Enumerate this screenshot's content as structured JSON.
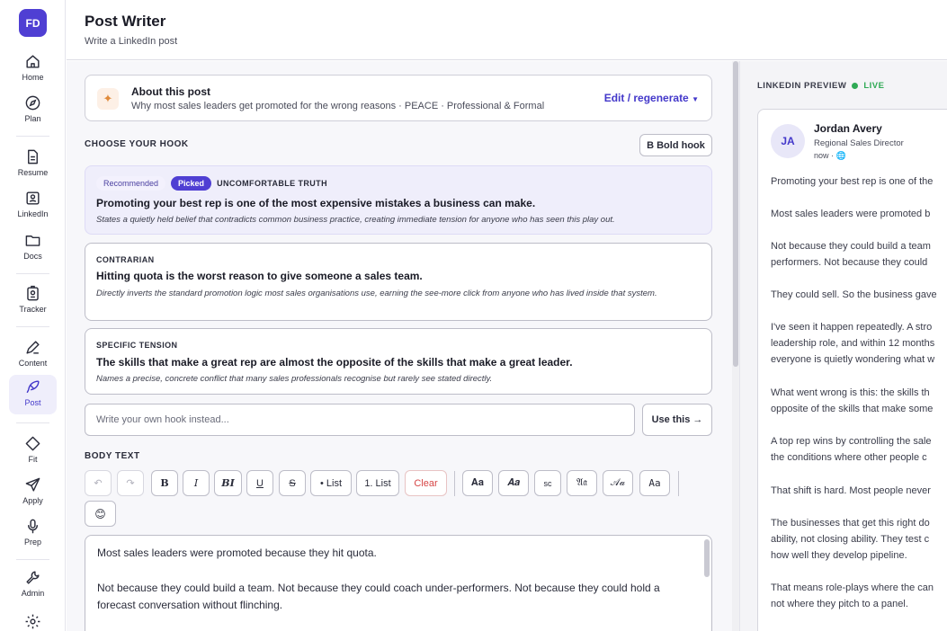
{
  "sidebar": {
    "avatar": "FD",
    "items": [
      {
        "label": "Home",
        "icon": "home-icon"
      },
      {
        "label": "Plan",
        "icon": "compass-icon"
      },
      {
        "label": "Resume",
        "icon": "document-icon"
      },
      {
        "label": "LinkedIn",
        "icon": "id-card-icon"
      },
      {
        "label": "Docs",
        "icon": "folder-icon"
      },
      {
        "label": "Tracker",
        "icon": "badge-icon"
      },
      {
        "label": "Content",
        "icon": "pen-icon"
      },
      {
        "label": "Post",
        "icon": "quill-icon"
      },
      {
        "label": "Fit",
        "icon": "diamond-icon"
      },
      {
        "label": "Apply",
        "icon": "send-icon"
      },
      {
        "label": "Prep",
        "icon": "microphone-icon"
      },
      {
        "label": "Admin",
        "icon": "wrench-icon"
      }
    ],
    "active": "Post"
  },
  "header": {
    "title": "Post Writer",
    "subtitle": "Write a LinkedIn post"
  },
  "about": {
    "title": "About this post",
    "summary": "Why most sales leaders get promoted for the wrong reasons · PEACE · Professional & Formal",
    "edit_label": "Edit / regenerate"
  },
  "hooks": {
    "section_label": "CHOOSE YOUR HOOK",
    "bold_hook_label": "B Bold hook",
    "items": [
      {
        "recommended": "Recommended",
        "picked": "Picked",
        "category": "UNCOMFORTABLE TRUTH",
        "title": "Promoting your best rep is one of the most expensive mistakes a business can make.",
        "description": "States a quietly held belief that contradicts common business practice, creating immediate tension for anyone who has seen this play out."
      },
      {
        "category": "CONTRARIAN",
        "title": "Hitting quota is the worst reason to give someone a sales team.",
        "description": "Directly inverts the standard promotion logic most sales organisations use, earning the see-more click from anyone who has lived inside that system."
      },
      {
        "category": "SPECIFIC TENSION",
        "title": "The skills that make a great rep are almost the opposite of the skills that make a great leader.",
        "description": "Names a precise, concrete conflict that many sales professionals recognise but rarely see stated directly."
      }
    ],
    "own_placeholder": "Write your own hook instead...",
    "use_label": "Use this →"
  },
  "body": {
    "section_label": "BODY TEXT",
    "toolbar": {
      "undo": "↶",
      "redo": "↷",
      "bold": "B",
      "italic": "I",
      "bold_italic": "BI",
      "underline": "U",
      "strike": "S",
      "bullet_list": "• List",
      "numbered_list": "1. List",
      "clear": "Clear",
      "serif_bold": "𝐀𝐚",
      "serif_bold_italic": "𝑨𝒂",
      "small_caps": "sc",
      "fraktur": "𝔄𝔞",
      "script": "𝒜𝒶",
      "sans": "Aa",
      "emoji": "😊"
    },
    "paragraphs": [
      "Most sales leaders were promoted because they hit quota.",
      "Not because they could build a team. Not because they could coach under-performers. Not because they could hold a forecast conversation without flinching."
    ]
  },
  "preview": {
    "label": "LINKEDIN PREVIEW",
    "live": "LIVE",
    "author": {
      "initials": "JA",
      "name": "Jordan Avery",
      "role": "Regional Sales Director",
      "time": "now ·"
    },
    "lines": [
      "Promoting your best rep is one of the",
      "Most sales leaders were promoted b",
      "Not because they could build a team",
      "performers. Not because they could",
      "They could sell. So the business gave",
      "I've seen it happen repeatedly. A stro",
      "leadership role, and within 12 months",
      "everyone is quietly wondering what w",
      "What went wrong is this: the skills th",
      "opposite of the skills that make some",
      "A top rep wins by controlling the sale",
      "the conditions where other people c",
      "That shift is hard. Most people never",
      "The businesses that get this right do",
      "ability, not closing ability. They test c",
      "how well they develop pipeline.",
      "That means role-plays where the can",
      "not where they pitch to a panel."
    ]
  }
}
